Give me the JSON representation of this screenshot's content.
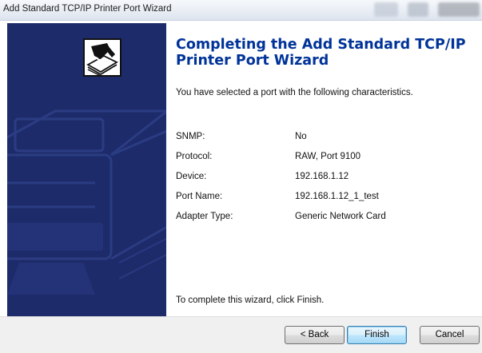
{
  "window": {
    "title": "Add Standard TCP/IP Printer Port Wizard"
  },
  "banner": {
    "background_color": "#1d2b6b",
    "icon": "printer-port-icon"
  },
  "content": {
    "heading": "Completing the Add Standard TCP/IP Printer Port Wizard",
    "intro": "You have selected a port with the following characteristics.",
    "properties": [
      {
        "label": "SNMP:",
        "value": "No"
      },
      {
        "label": "Protocol:",
        "value": "RAW, Port 9100"
      },
      {
        "label": "Device:",
        "value": "192.168.1.12"
      },
      {
        "label": "Port Name:",
        "value": "192.168.1.12_1_test"
      },
      {
        "label": "Adapter Type:",
        "value": "Generic Network Card"
      }
    ],
    "footer": "To complete this wizard, click Finish."
  },
  "buttons": {
    "back": "< Back",
    "finish": "Finish",
    "cancel": "Cancel"
  },
  "colors": {
    "heading": "#003399",
    "banner": "#1d2b6b",
    "default_button_border": "#3c7fb1"
  }
}
